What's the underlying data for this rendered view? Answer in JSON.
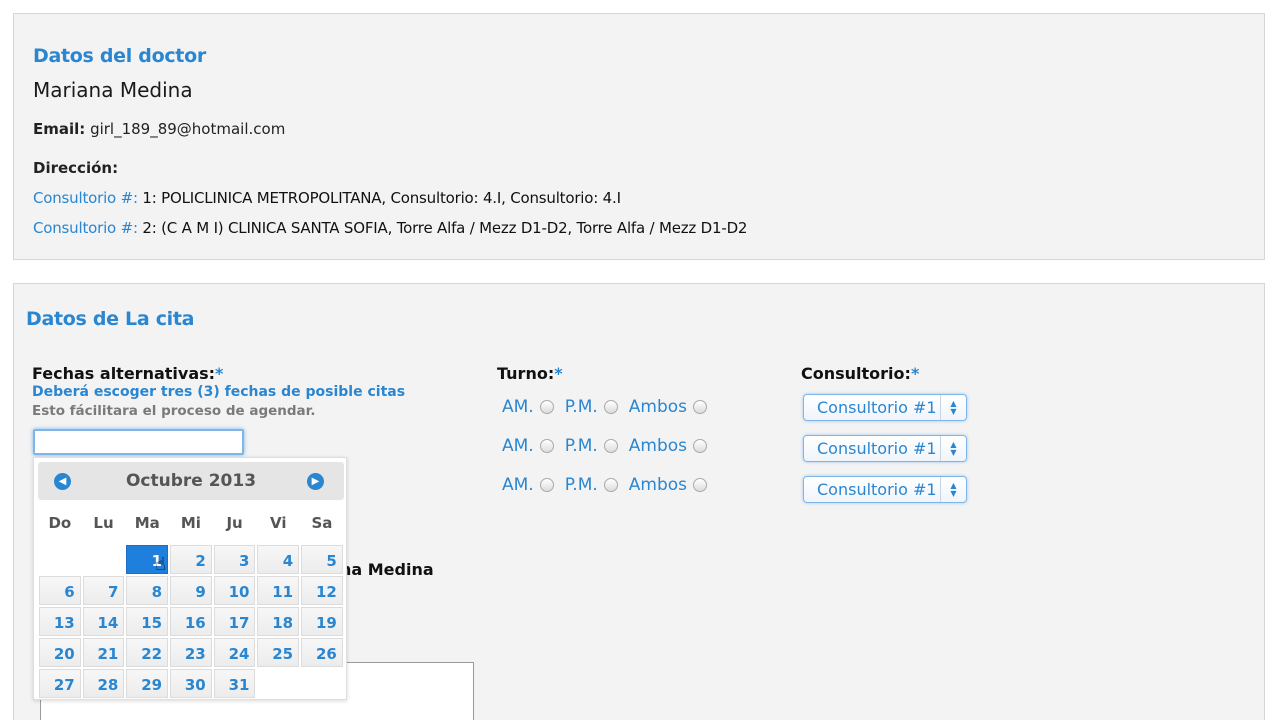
{
  "doctor": {
    "title": "Datos del doctor",
    "name": "Mariana Medina",
    "email_label": "Email:",
    "email_value": "girl_189_89@hotmail.com",
    "direccion_label": "Dirección:",
    "consultorios": [
      {
        "label": "Consultorio #:",
        "text": " 1: POLICLINICA METROPOLITANA, Consultorio: 4.I, Consultorio: 4.I"
      },
      {
        "label": "Consultorio #:",
        "text": " 2: (C A M I) CLINICA SANTA SOFIA, Torre Alfa / Mezz D1-D2, Torre Alfa / Mezz D1-D2"
      }
    ]
  },
  "cita": {
    "title": "Datos de La cita",
    "fechas_label": "Fechas alternativas:",
    "required_mark": "*",
    "hint_blue": "Deberá escoger tres (3) fechas de posible citas",
    "hint_gray": "Esto fácilitara el proceso de agendar.",
    "date_input_value": "",
    "turno_label": "Turno:",
    "consultorio_label": "Consultorio:",
    "turno_options": {
      "am": "AM.",
      "pm": "P.M.",
      "ambos": "Ambos"
    },
    "consultorio_selects": [
      "Consultorio #1",
      "Consultorio #1",
      "Consultorio #1"
    ],
    "partial_text": "na Medina"
  },
  "datepicker": {
    "month_title": "Octubre 2013",
    "weekdays": [
      "Do",
      "Lu",
      "Ma",
      "Mi",
      "Ju",
      "Vi",
      "Sa"
    ],
    "leading_empty": 2,
    "days_in_month": 31,
    "selected_day": 1
  },
  "icons": {
    "prev": "chevron-left-icon",
    "next": "chevron-right-icon",
    "select_arrows": "up-down-arrows-icon",
    "cursor": "hand-pointer-icon"
  },
  "colors": {
    "accent": "#2a86d0",
    "selected_day": "#1f7fdc",
    "panel_bg": "#f3f3f3"
  }
}
